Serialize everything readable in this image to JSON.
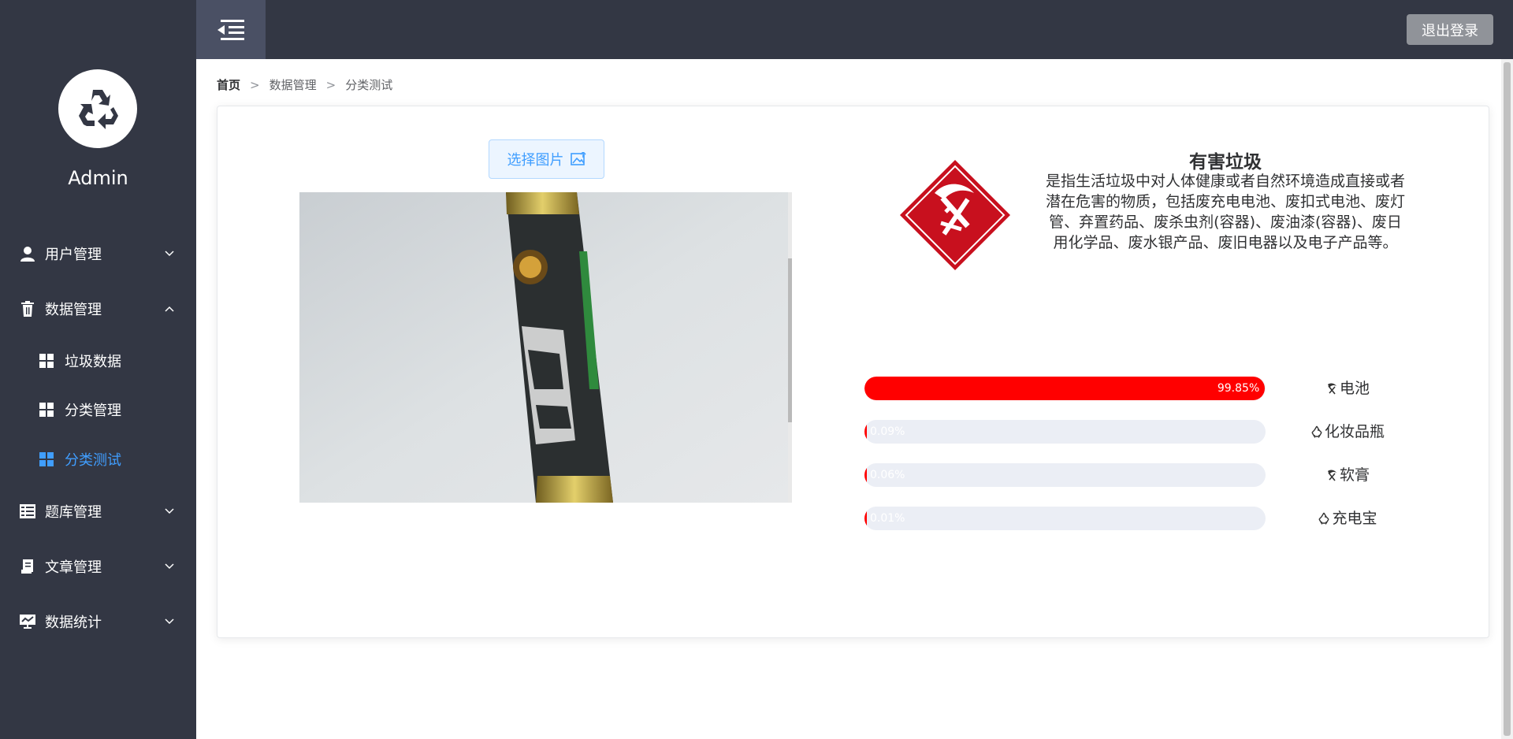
{
  "sidebar": {
    "user_name": "Admin",
    "menu": [
      {
        "label": "用户管理",
        "icon": "user-icon",
        "expanded": false
      },
      {
        "label": "数据管理",
        "icon": "trash-icon",
        "expanded": true
      },
      {
        "label": "题库管理",
        "icon": "list-icon",
        "expanded": false
      },
      {
        "label": "文章管理",
        "icon": "document-icon",
        "expanded": false
      },
      {
        "label": "数据统计",
        "icon": "chart-icon",
        "expanded": false
      }
    ],
    "submenu": [
      {
        "label": "垃圾数据",
        "icon": "grid-icon",
        "active": false
      },
      {
        "label": "分类管理",
        "icon": "grid-icon",
        "active": false
      },
      {
        "label": "分类测试",
        "icon": "grid-icon",
        "active": true
      }
    ],
    "active_color": "#409eff",
    "background": "#333744"
  },
  "header": {
    "logout_label": "退出登录"
  },
  "breadcrumb": [
    "首页",
    "数据管理",
    "分类测试"
  ],
  "breadcrumb_separator": ">",
  "upload": {
    "button_label": "选择图片"
  },
  "result": {
    "category": "有害垃圾",
    "description": "是指生活垃圾中对人体健康或者自然环境造成直接或者潜在危害的物质，包括废充电电池、废扣式电池、废灯管、弃置药品、废杀虫剂(容器)、废油漆(容器)、废日用化学品、废水银产品、废旧电器以及电子产品等。",
    "predictions": [
      {
        "percent_label": "99.85%",
        "value": 99.85,
        "label": "电池",
        "icon": "hazardous-icon"
      },
      {
        "percent_label": "0.09%",
        "value": 0.09,
        "label": "化妆品瓶",
        "icon": "recyclable-icon"
      },
      {
        "percent_label": "0.06%",
        "value": 0.06,
        "label": "软膏",
        "icon": "hazardous-icon"
      },
      {
        "percent_label": "0.01%",
        "value": 0.01,
        "label": "充电宝",
        "icon": "recyclable-icon"
      }
    ],
    "bar_color": "#ff0000"
  }
}
